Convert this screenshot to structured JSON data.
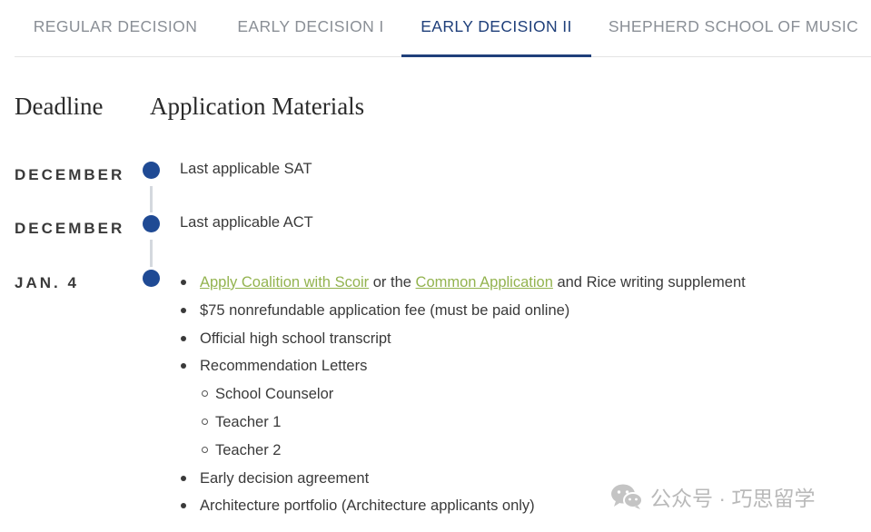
{
  "tabs": [
    {
      "label": "REGULAR DECISION",
      "active": false
    },
    {
      "label": "EARLY DECISION I",
      "active": false
    },
    {
      "label": "EARLY DECISION II",
      "active": true
    },
    {
      "label": "SHEPHERD SCHOOL OF MUSIC",
      "active": false
    }
  ],
  "headings": {
    "deadline": "Deadline",
    "materials": "Application Materials"
  },
  "timeline": [
    {
      "date": "DECEMBER",
      "text": "Last applicable SAT"
    },
    {
      "date": "DECEMBER",
      "text": "Last applicable ACT"
    },
    {
      "date": "JAN. 4"
    }
  ],
  "materials": {
    "line1": {
      "link1": "Apply Coalition with Scoir",
      "mid": " or the ",
      "link2": "Common Application",
      "rest": " and Rice writing supplement"
    },
    "fee": "$75 nonrefundable application fee (must be paid online)",
    "transcript": "Official high school transcript",
    "recommendations": "Recommendation Letters",
    "recommenders": [
      "School Counselor",
      "Teacher 1",
      "Teacher 2"
    ],
    "agreement": "Early decision agreement",
    "portfolio": "Architecture portfolio (Architecture applicants only)"
  },
  "watermark": {
    "text": "公众号 · 巧思留学",
    "icon": "wechat-icon"
  },
  "colors": {
    "accent": "#1f3f7a",
    "dot": "#1f4a94",
    "link": "#93b34f"
  }
}
